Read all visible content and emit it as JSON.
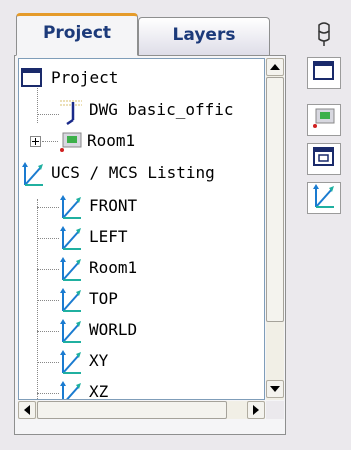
{
  "tabs": [
    {
      "label": "Project"
    },
    {
      "label": "Layers"
    }
  ],
  "tree": {
    "items": [
      {
        "label": "Project",
        "icon": "project-frame-icon"
      },
      {
        "label": "DWG basic_offic",
        "icon": "dwg-pen-icon"
      },
      {
        "label": "Room1",
        "icon": "room-icon"
      },
      {
        "label": "UCS / MCS Listing",
        "icon": "ucs-axes-icon"
      },
      {
        "label": "FRONT",
        "icon": "ucs-axes-icon"
      },
      {
        "label": "LEFT",
        "icon": "ucs-axes-icon"
      },
      {
        "label": "Room1",
        "icon": "ucs-axes-icon"
      },
      {
        "label": "TOP",
        "icon": "ucs-axes-icon"
      },
      {
        "label": "WORLD",
        "icon": "ucs-axes-icon"
      },
      {
        "label": "XY",
        "icon": "ucs-axes-icon"
      },
      {
        "label": "XZ",
        "icon": "ucs-axes-icon"
      }
    ]
  },
  "side_toolbar": [
    "pin-icon",
    "project-frame-icon",
    "room-icon",
    "view-frame-icon",
    "ucs-axes-icon"
  ],
  "colors": {
    "tab_text": "#1c3a7a",
    "active_tab_accent": "#e59b2a",
    "tree_border": "#7f9db9"
  }
}
